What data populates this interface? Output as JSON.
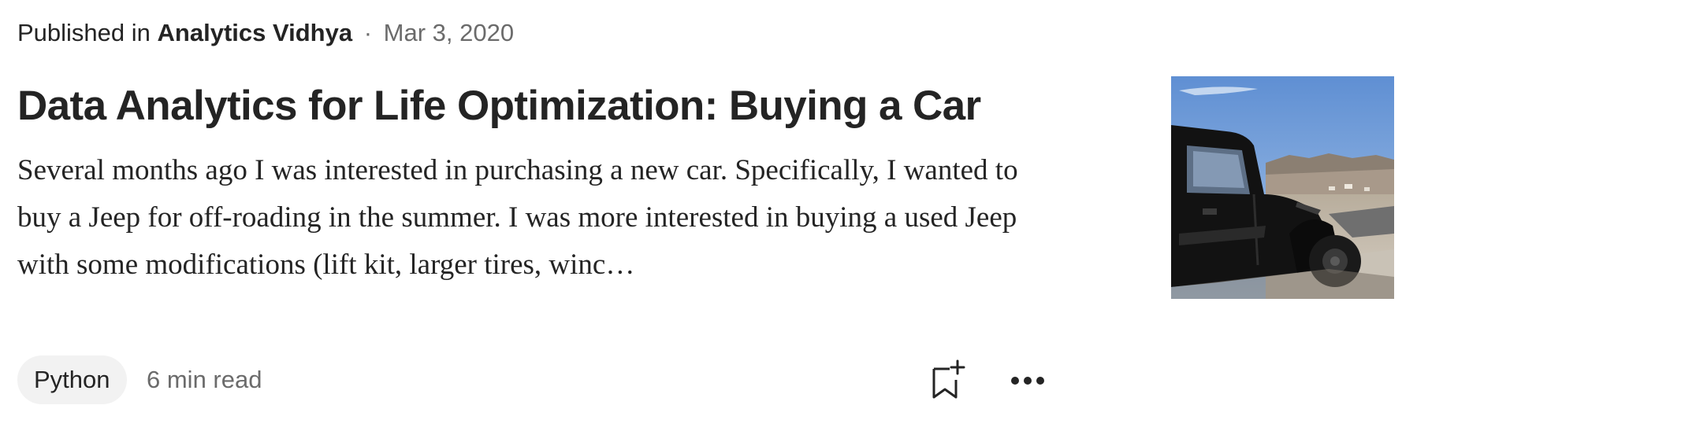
{
  "meta": {
    "prefix": "Published in",
    "publication": "Analytics Vidhya",
    "separator": "·",
    "date": "Mar 3, 2020"
  },
  "article": {
    "title": "Data Analytics for Life Optimization: Buying a Car",
    "excerpt": "Several months ago I was interested in purchasing a new car. Specifically, I wanted to buy a Jeep for off-roading in the summer. I was more interested in buying a used Jeep with some modifications (lift kit, larger tires, winc…",
    "thumbnail_icon": "jeep-photo"
  },
  "footer": {
    "tag": "Python",
    "read_time": "6 min read",
    "bookmark_icon": "bookmark-add-icon",
    "more_icon": "more-horizontal-icon"
  },
  "colors": {
    "text": "#242424",
    "muted": "#6b6b6b",
    "tag_bg": "#f2f2f2"
  }
}
